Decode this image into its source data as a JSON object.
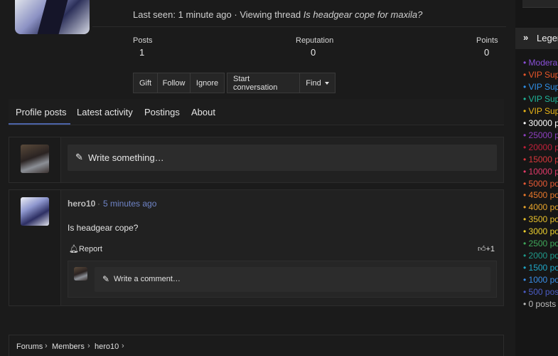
{
  "profile": {
    "last_seen_prefix": "Last seen: 1 minute ago · Viewing thread ",
    "last_seen_thread": "Is headgear cope for maxila?",
    "stats": [
      {
        "label": "Posts",
        "value": "1"
      },
      {
        "label": "Reputation",
        "value": "0"
      },
      {
        "label": "Points",
        "value": "0"
      }
    ],
    "buttons": {
      "gift": "Gift",
      "follow": "Follow",
      "ignore": "Ignore",
      "start_conversation": "Start conversation",
      "find": "Find"
    }
  },
  "tabs": [
    "Profile posts",
    "Latest activity",
    "Postings",
    "About"
  ],
  "composer": {
    "placeholder": "Write something…"
  },
  "post": {
    "author": "hero10",
    "separator": "·",
    "time": "5 minutes ago",
    "message": "Is headgear cope?",
    "report_label": "Report",
    "like_label": "+1",
    "comment_placeholder": "Write a comment…"
  },
  "breadcrumb": [
    "Forums",
    "Members",
    "hero10"
  ],
  "sidebar": {
    "legend_title": "Legend",
    "items": [
      {
        "text": "• Modera",
        "color": "#8a4fd8"
      },
      {
        "text": "• VIP Sup",
        "color": "#e8562a"
      },
      {
        "text": "• VIP Sup",
        "color": "#2f8fe8"
      },
      {
        "text": "• VIP Sup",
        "color": "#1fb59a"
      },
      {
        "text": "• VIP Sup",
        "color": "#e8b417"
      },
      {
        "text": "• 30000 p",
        "color": "#ffffff"
      },
      {
        "text": "• 25000 p",
        "color": "#8e3fbf"
      },
      {
        "text": "• 20000 p",
        "color": "#c2203a"
      },
      {
        "text": "• 15000 p",
        "color": "#d8373b"
      },
      {
        "text": "• 10000 p",
        "color": "#e23a6a"
      },
      {
        "text": "• 5000 po",
        "color": "#e85a35"
      },
      {
        "text": "• 4500 po",
        "color": "#e8772a"
      },
      {
        "text": "• 4000 po",
        "color": "#e8a42a"
      },
      {
        "text": "• 3500 po",
        "color": "#e8c02a"
      },
      {
        "text": "• 3000 po",
        "color": "#eed12d"
      },
      {
        "text": "• 2500 po",
        "color": "#3fa85a"
      },
      {
        "text": "• 2000 po",
        "color": "#1f9a8a"
      },
      {
        "text": "• 1500 po",
        "color": "#1fa8c8"
      },
      {
        "text": "• 1000 po",
        "color": "#3a8ee8"
      },
      {
        "text": "• 500 pos",
        "color": "#4b5cc4"
      },
      {
        "text": "• 0 posts",
        "color": "#bdbdbd"
      }
    ]
  }
}
